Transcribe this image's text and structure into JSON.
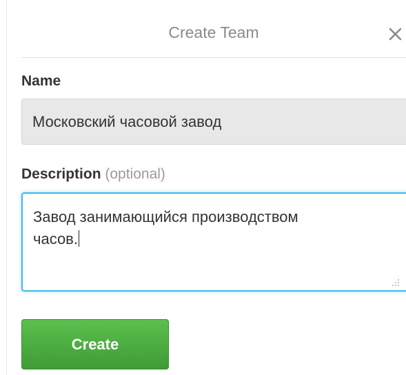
{
  "dialog": {
    "title": "Create Team",
    "close_icon": "close-icon"
  },
  "form": {
    "name_label": "Name",
    "name_value": "Московский часовой завод",
    "description_label": "Description",
    "description_optional": "(optional)",
    "description_value": "Завод занимающийся производством\nчасов.",
    "resize_icon": "resize-grip-icon",
    "create_label": "Create"
  },
  "colors": {
    "create_button": "#4cae43",
    "focus_border": "#3db6f0",
    "input_disabled_bg": "#e8e8e8"
  }
}
